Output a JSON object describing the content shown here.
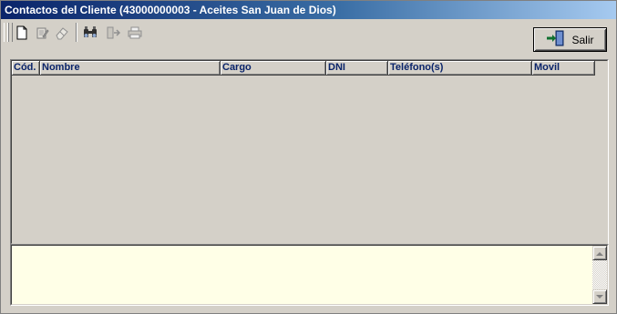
{
  "window": {
    "title": "Contactos del Cliente (43000000003 - Aceites San Juan de Dios)"
  },
  "toolbar": {
    "buttons": [
      {
        "icon": "new-document-icon",
        "enabled": true
      },
      {
        "icon": "edit-icon",
        "enabled": false
      },
      {
        "icon": "eraser-icon",
        "enabled": false
      },
      {
        "icon": "binoculars-icon",
        "enabled": true
      },
      {
        "icon": "export-icon",
        "enabled": false
      },
      {
        "icon": "printer-icon",
        "enabled": false
      }
    ]
  },
  "exit_button": {
    "label": "Salir",
    "icon": "exit-door-icon"
  },
  "grid": {
    "columns": [
      {
        "key": "cod",
        "label": "Cód."
      },
      {
        "key": "nombre",
        "label": "Nombre"
      },
      {
        "key": "cargo",
        "label": "Cargo"
      },
      {
        "key": "dni",
        "label": "DNI"
      },
      {
        "key": "telefonos",
        "label": "Teléfono(s)"
      },
      {
        "key": "movil",
        "label": "Movil"
      }
    ],
    "rows": []
  },
  "memo": {
    "text": ""
  },
  "colors": {
    "title_start": "#0a246a",
    "title_end": "#a6caf0",
    "header_text": "#0a246a",
    "memo_background": "#ffffe7",
    "face": "#d4d0c8"
  }
}
